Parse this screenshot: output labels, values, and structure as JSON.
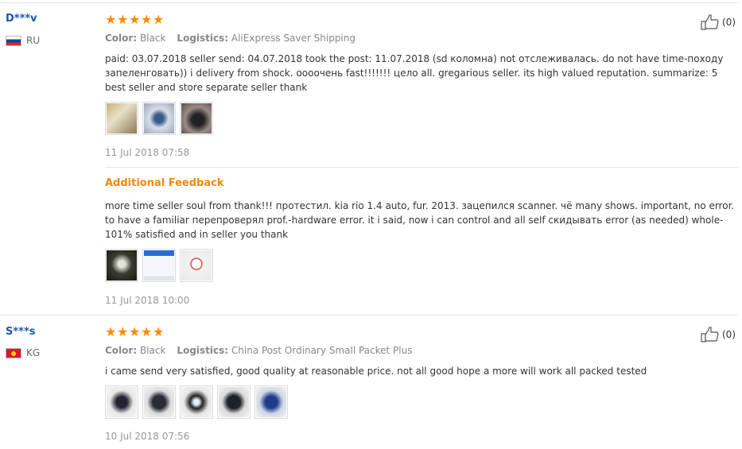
{
  "reviews": [
    {
      "user": "D***v",
      "country": "RU",
      "like_count": "(0)",
      "color_label": "Color:",
      "color_value": "Black",
      "logistics_label": "Logistics:",
      "logistics_value": "AliExpress Saver Shipping",
      "text": "paid: 03.07.2018 seller send: 04.07.2018 took the post: 11.07.2018 (sd коломна) not отслеживалась. do not have time-походу запеленговать)) i delivery from shock. оооочень fast!!!!!!! цело all. gregarious seller. its high valued reputation. summarize: 5 best seller and store separate seller thank",
      "date": "11 Jul 2018 07:58",
      "additional_title": "Additional Feedback",
      "additional_text": "more time seller soul from thank!!! протестил. kia rio 1.4 auto, fur. 2013. зацепился scanner. чё many shows. important, no error. to have a familiar перепроверял prof.-hardware error. it i said, now i can control and all self скидывать error (as needed) whole-101% satisfied and in seller you thank",
      "additional_date": "11 Jul 2018 10:00"
    },
    {
      "user": "S***s",
      "country": "KG",
      "like_count": "(0)",
      "color_label": "Color:",
      "color_value": "Black",
      "logistics_label": "Logistics:",
      "logistics_value": "China Post Ordinary Small Packet Plus",
      "text": "i came send very satisfied, good quality at reasonable price. not all good hope a more will work all packed tested",
      "date": "10 Jul 2018 07:56"
    }
  ],
  "colors": {
    "accent": "#ff8a00",
    "username": "#1a5aa8",
    "additional": "#f08a0c"
  }
}
